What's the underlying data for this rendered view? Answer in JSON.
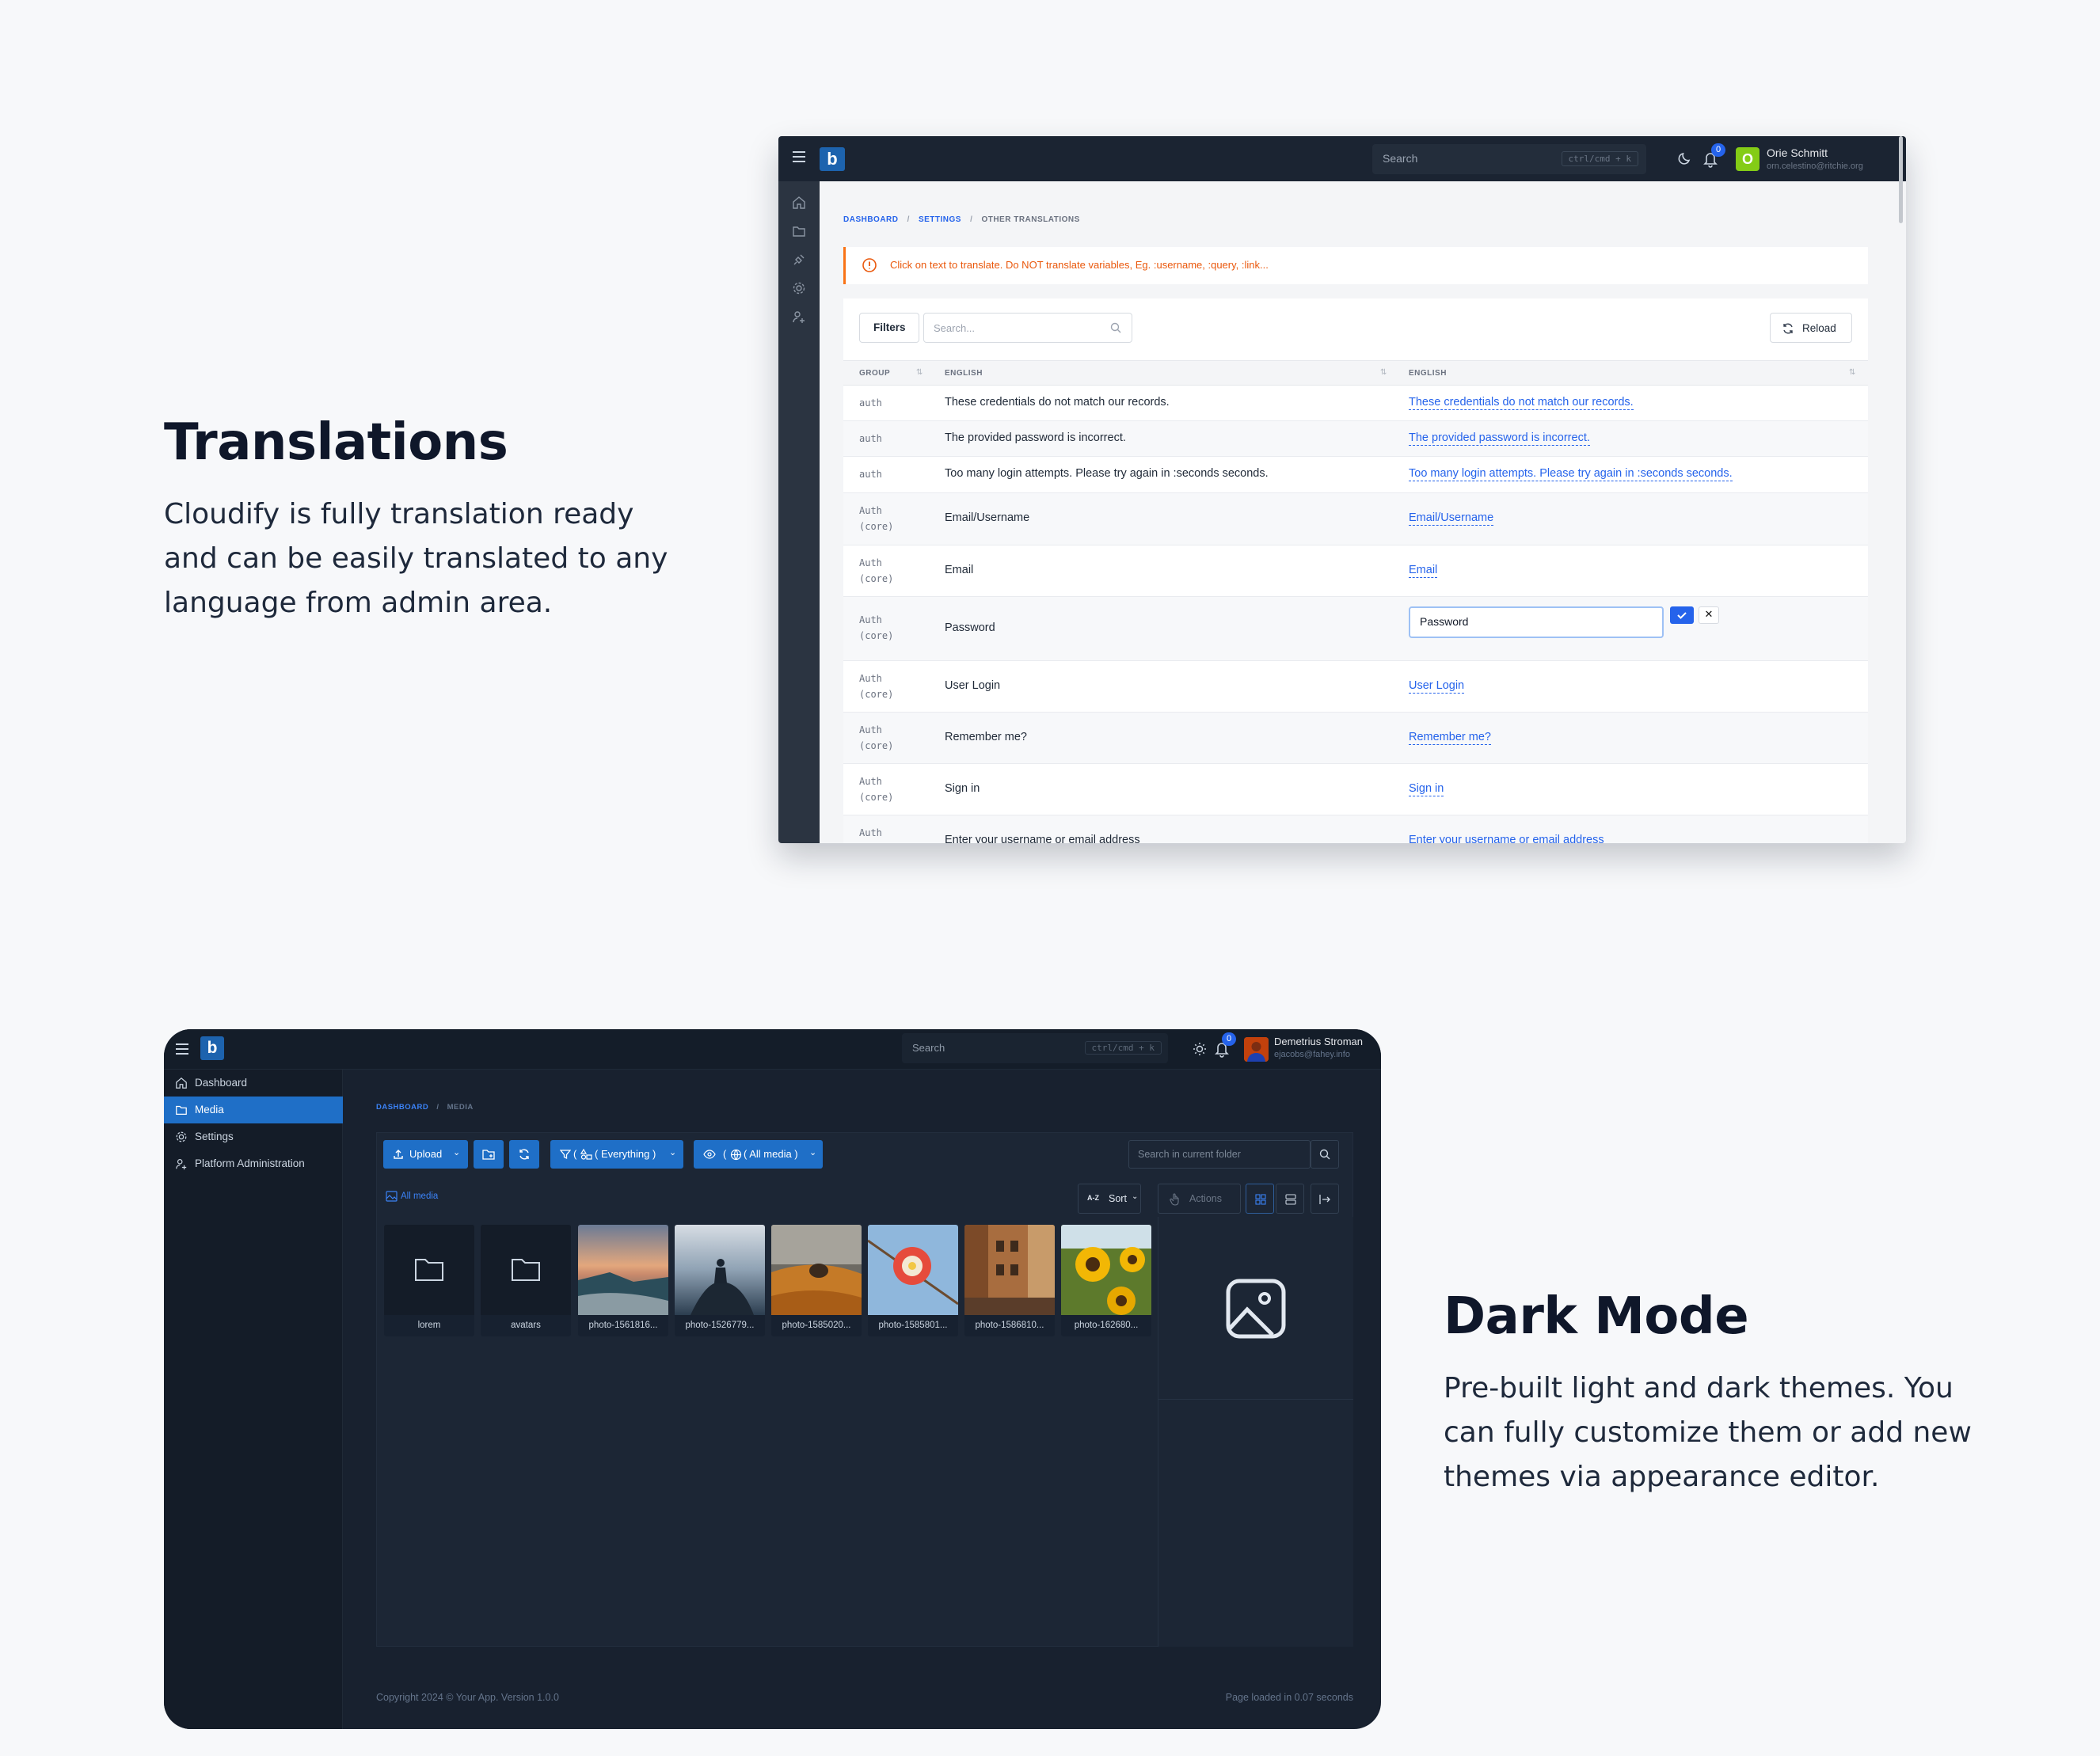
{
  "sections": {
    "translations": {
      "title": "Translations",
      "description": "Cloudify is fully translation ready and can be easily translated to any language from admin area."
    },
    "dark_mode": {
      "title": "Dark Mode",
      "description": "Pre-built light and dark themes. You can fully customize them or add new themes via appearance editor."
    }
  },
  "light_app": {
    "logo_letter": "b",
    "search_placeholder": "Search",
    "search_shortcut": "ctrl/cmd + k",
    "notifications_count": "0",
    "user": {
      "initial": "O",
      "name": "Orie Schmitt",
      "email": "orn.celestino@ritchie.org"
    },
    "breadcrumb": [
      "DASHBOARD",
      "SETTINGS",
      "OTHER TRANSLATIONS"
    ],
    "breadcrumb_sep": "/",
    "alert_text": "Click on text to translate. Do NOT translate variables, Eg. :username, :query, :link...",
    "filters_label": "Filters",
    "search_placeholder_table": "Search...",
    "reload_label": "Reload",
    "columns": [
      "GROUP",
      "ENGLISH",
      "ENGLISH"
    ],
    "rows": [
      {
        "group": "auth",
        "group2": "",
        "source": "These credentials do not match our records.",
        "translation": "These credentials do not match our records."
      },
      {
        "group": "auth",
        "group2": "",
        "source": "The provided password is incorrect.",
        "translation": "The provided password is incorrect."
      },
      {
        "group": "auth",
        "group2": "",
        "source": "Too many login attempts. Please try again in :seconds seconds.",
        "translation": "Too many login attempts. Please try again in :seconds seconds."
      },
      {
        "group": "Auth",
        "group2": "(core)",
        "source": "Email/Username",
        "translation": "Email/Username"
      },
      {
        "group": "Auth",
        "group2": "(core)",
        "source": "Email",
        "translation": "Email"
      },
      {
        "group": "Auth",
        "group2": "(core)",
        "source": "Password",
        "translation": "Password",
        "editing": true
      },
      {
        "group": "Auth",
        "group2": "(core)",
        "source": "User Login",
        "translation": "User Login"
      },
      {
        "group": "Auth",
        "group2": "(core)",
        "source": "Remember me?",
        "translation": "Remember me?"
      },
      {
        "group": "Auth",
        "group2": "(core)",
        "source": "Sign in",
        "translation": "Sign in"
      },
      {
        "group": "Auth",
        "group2": "",
        "source": "Enter your username or email address",
        "translation": "Enter your username or email address"
      }
    ],
    "cancel_glyph": "✕"
  },
  "dark_app": {
    "logo_letter": "b",
    "search_placeholder": "Search",
    "search_shortcut": "ctrl/cmd + k",
    "notifications_count": "0",
    "user": {
      "name": "Demetrius Stroman",
      "email": "ejacobs@fahey.info"
    },
    "nav": [
      "Dashboard",
      "Media",
      "Settings",
      "Platform Administration"
    ],
    "active_nav": "Media",
    "breadcrumb": [
      "DASHBOARD",
      "MEDIA"
    ],
    "breadcrumb_sep": "/",
    "toolbar": {
      "upload": "Upload",
      "filter": "( Everything )",
      "visibility": "( All media )",
      "search_placeholder": "Search in current folder",
      "sort": "Sort",
      "actions": "Actions"
    },
    "folder_path": "All media",
    "items": [
      {
        "name": "lorem",
        "kind": "folder"
      },
      {
        "name": "avatars",
        "kind": "folder"
      },
      {
        "name": "photo-1561816...",
        "kind": "image"
      },
      {
        "name": "photo-1526779...",
        "kind": "image"
      },
      {
        "name": "photo-1585020...",
        "kind": "image"
      },
      {
        "name": "photo-1585801...",
        "kind": "image"
      },
      {
        "name": "photo-1586810...",
        "kind": "image"
      },
      {
        "name": "photo-162680...",
        "kind": "image"
      }
    ],
    "footer_left": "Copyright 2024 © Your App. Version 1.0.0",
    "footer_right": "Page loaded in 0.07 seconds"
  }
}
